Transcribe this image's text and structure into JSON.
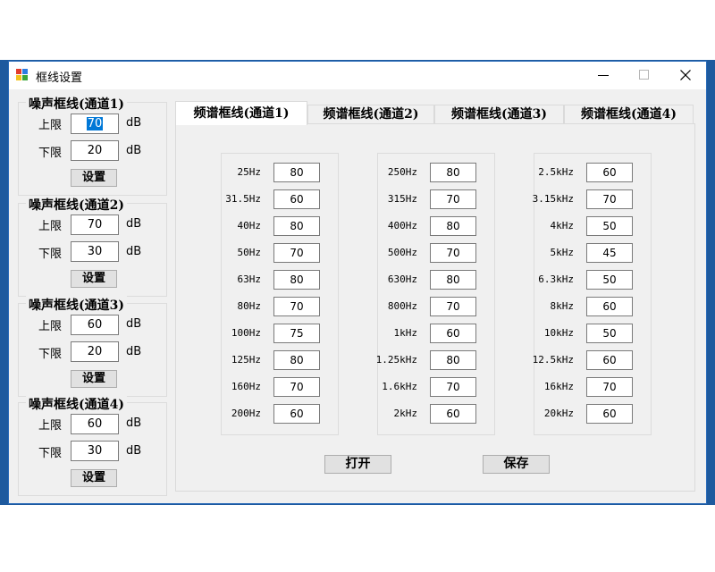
{
  "window": {
    "title": "框线设置",
    "accent": "#0078d7"
  },
  "noise_groups": [
    {
      "title": "噪声框线(通道1)",
      "upper_label": "上限",
      "upper_value": "70",
      "lower_label": "下限",
      "lower_value": "20",
      "unit": "dB",
      "set_label": "设置"
    },
    {
      "title": "噪声框线(通道2)",
      "upper_label": "上限",
      "upper_value": "70",
      "lower_label": "下限",
      "lower_value": "30",
      "unit": "dB",
      "set_label": "设置"
    },
    {
      "title": "噪声框线(通道3)",
      "upper_label": "上限",
      "upper_value": "60",
      "lower_label": "下限",
      "lower_value": "20",
      "unit": "dB",
      "set_label": "设置"
    },
    {
      "title": "噪声框线(通道4)",
      "upper_label": "上限",
      "upper_value": "60",
      "lower_label": "下限",
      "lower_value": "30",
      "unit": "dB",
      "set_label": "设置"
    }
  ],
  "tabs": [
    {
      "label": "频谱框线(通道1)",
      "active": true
    },
    {
      "label": "频谱框线(通道2)",
      "active": false
    },
    {
      "label": "频谱框线(通道3)",
      "active": false
    },
    {
      "label": "频谱框线(通道4)",
      "active": false
    }
  ],
  "spectrum": {
    "columns": [
      [
        {
          "freq": "25Hz",
          "value": "80"
        },
        {
          "freq": "31.5Hz",
          "value": "60"
        },
        {
          "freq": "40Hz",
          "value": "80"
        },
        {
          "freq": "50Hz",
          "value": "70"
        },
        {
          "freq": "63Hz",
          "value": "80"
        },
        {
          "freq": "80Hz",
          "value": "70"
        },
        {
          "freq": "100Hz",
          "value": "75"
        },
        {
          "freq": "125Hz",
          "value": "80"
        },
        {
          "freq": "160Hz",
          "value": "70"
        },
        {
          "freq": "200Hz",
          "value": "60"
        }
      ],
      [
        {
          "freq": "250Hz",
          "value": "80"
        },
        {
          "freq": "315Hz",
          "value": "70"
        },
        {
          "freq": "400Hz",
          "value": "80"
        },
        {
          "freq": "500Hz",
          "value": "70"
        },
        {
          "freq": "630Hz",
          "value": "80"
        },
        {
          "freq": "800Hz",
          "value": "70"
        },
        {
          "freq": "1kHz",
          "value": "60"
        },
        {
          "freq": "1.25kHz",
          "value": "80"
        },
        {
          "freq": "1.6kHz",
          "value": "70"
        },
        {
          "freq": "2kHz",
          "value": "60"
        }
      ],
      [
        {
          "freq": "2.5kHz",
          "value": "60"
        },
        {
          "freq": "3.15kHz",
          "value": "70"
        },
        {
          "freq": "4kHz",
          "value": "50"
        },
        {
          "freq": "5kHz",
          "value": "45"
        },
        {
          "freq": "6.3kHz",
          "value": "50"
        },
        {
          "freq": "8kHz",
          "value": "60"
        },
        {
          "freq": "10kHz",
          "value": "50"
        },
        {
          "freq": "12.5kHz",
          "value": "60"
        },
        {
          "freq": "16kHz",
          "value": "70"
        },
        {
          "freq": "20kHz",
          "value": "60"
        }
      ]
    ],
    "open_label": "打开",
    "save_label": "保存"
  }
}
